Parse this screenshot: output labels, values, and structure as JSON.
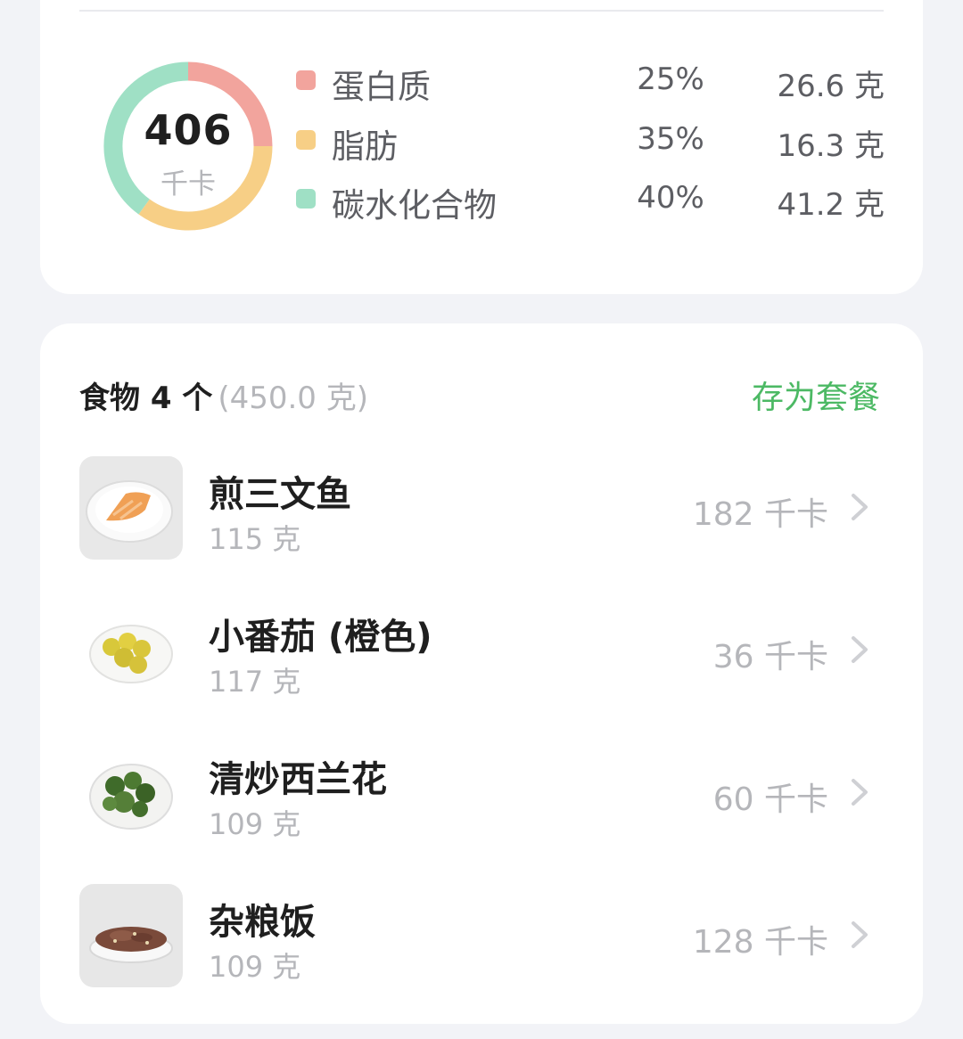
{
  "summary": {
    "total_kcal": "406",
    "kcal_unit": "千卡",
    "macros": [
      {
        "name": "蛋白质",
        "percent": "25%",
        "amount": "26.6 克",
        "color": "#f2a49d",
        "fraction": 0.25
      },
      {
        "name": "脂肪",
        "percent": "35%",
        "amount": "16.3 克",
        "color": "#f7cf86",
        "fraction": 0.35
      },
      {
        "name": "碳水化合物",
        "percent": "40%",
        "amount": "41.2 克",
        "color": "#9fe0c5",
        "fraction": 0.4
      }
    ]
  },
  "food_list": {
    "title": "食物 4 个",
    "total_weight": "(450.0 克)",
    "save_label": "存为套餐",
    "items": [
      {
        "name": "煎三文鱼",
        "weight": "115 克",
        "kcal": "182 千卡",
        "icon": "salmon-plate"
      },
      {
        "name": "小番茄 (橙色)",
        "weight": "117 克",
        "kcal": "36 千卡",
        "icon": "tomato-plate"
      },
      {
        "name": "清炒西兰花",
        "weight": "109 克",
        "kcal": "60 千卡",
        "icon": "broccoli-plate"
      },
      {
        "name": "杂粮饭",
        "weight": "109 克",
        "kcal": "128 千卡",
        "icon": "rice-plate"
      }
    ]
  },
  "colors": {
    "accent": "#4cb964",
    "muted": "#b5b6ba",
    "text": "#1f1f1f"
  }
}
